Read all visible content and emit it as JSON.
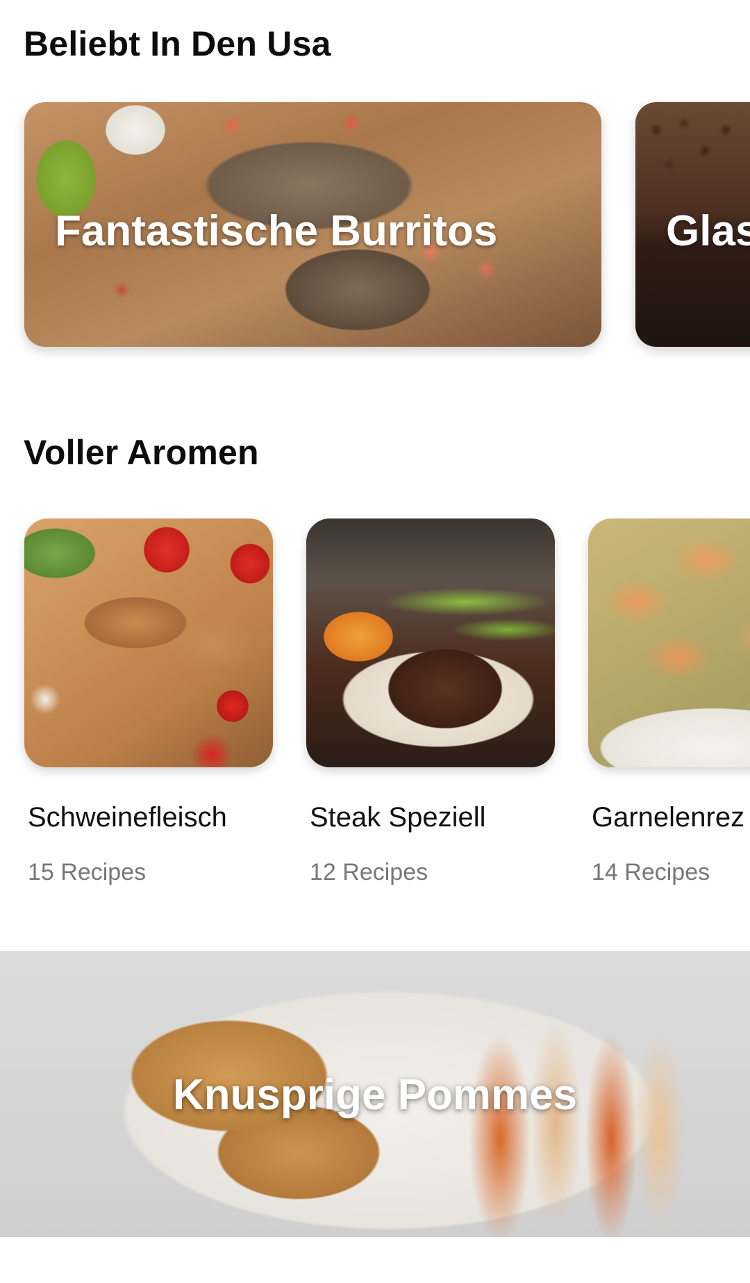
{
  "sections": [
    {
      "title": "Beliebt In Den Usa",
      "cards": [
        {
          "title": "Fantastische Burritos"
        },
        {
          "title": "Glas"
        }
      ]
    },
    {
      "title": "Voller Aromen",
      "cards": [
        {
          "name": "Schweinefleisch",
          "count": "15 Recipes"
        },
        {
          "name": "Steak Speziell",
          "count": "12 Recipes"
        },
        {
          "name": "Garnelenrez",
          "count": "14 Recipes"
        }
      ]
    }
  ],
  "hero": {
    "title": "Knusprige Pommes"
  }
}
